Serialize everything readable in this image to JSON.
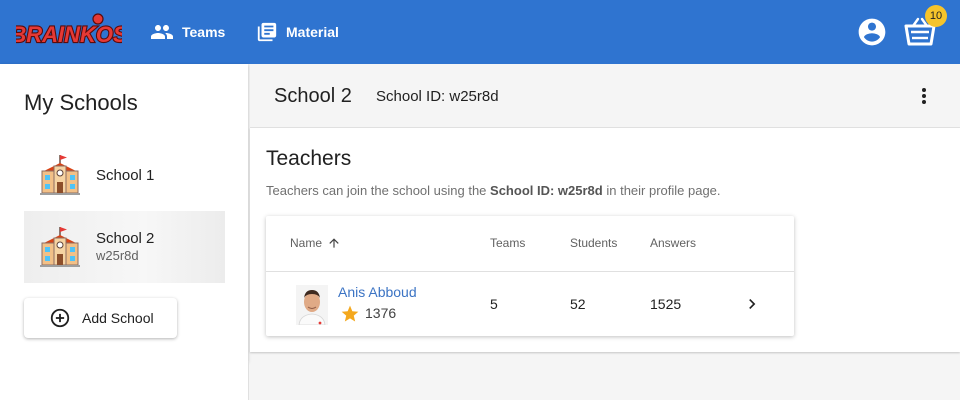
{
  "app": {
    "logo_text": "BRAINKOS",
    "brand_color": "#2f74d0",
    "accent_color": "#f6c42b"
  },
  "nav": {
    "teams": {
      "label": "Teams",
      "icon": "people-icon"
    },
    "material": {
      "label": "Material",
      "icon": "library-books-icon"
    }
  },
  "header_actions": {
    "account_icon": "account-circle-icon",
    "cart_icon": "basket-icon",
    "cart_count": "10"
  },
  "sidebar": {
    "title": "My Schools",
    "schools": [
      {
        "name": "School 1",
        "subtitle": "",
        "icon": "school-building-icon",
        "selected": false
      },
      {
        "name": "School 2",
        "subtitle": "w25r8d",
        "icon": "school-building-icon",
        "selected": true
      }
    ],
    "add_button": {
      "label": "Add School",
      "icon": "add-circle-icon"
    }
  },
  "school_header": {
    "title": "School 2",
    "id_text": "School ID: w25r8d",
    "menu_icon": "more-vert-icon"
  },
  "teachers": {
    "title": "Teachers",
    "desc_prefix": "Teachers can join the school using the ",
    "desc_bold": "School ID: w25r8d",
    "desc_suffix": " in their profile page.",
    "columns": {
      "name": "Name",
      "teams": "Teams",
      "students": "Students",
      "answers": "Answers"
    },
    "sort_icon": "arrow-up-icon",
    "rows": [
      {
        "name": "Anis Abboud",
        "score": "1376",
        "teams": "5",
        "students": "52",
        "answers": "1525"
      }
    ]
  }
}
